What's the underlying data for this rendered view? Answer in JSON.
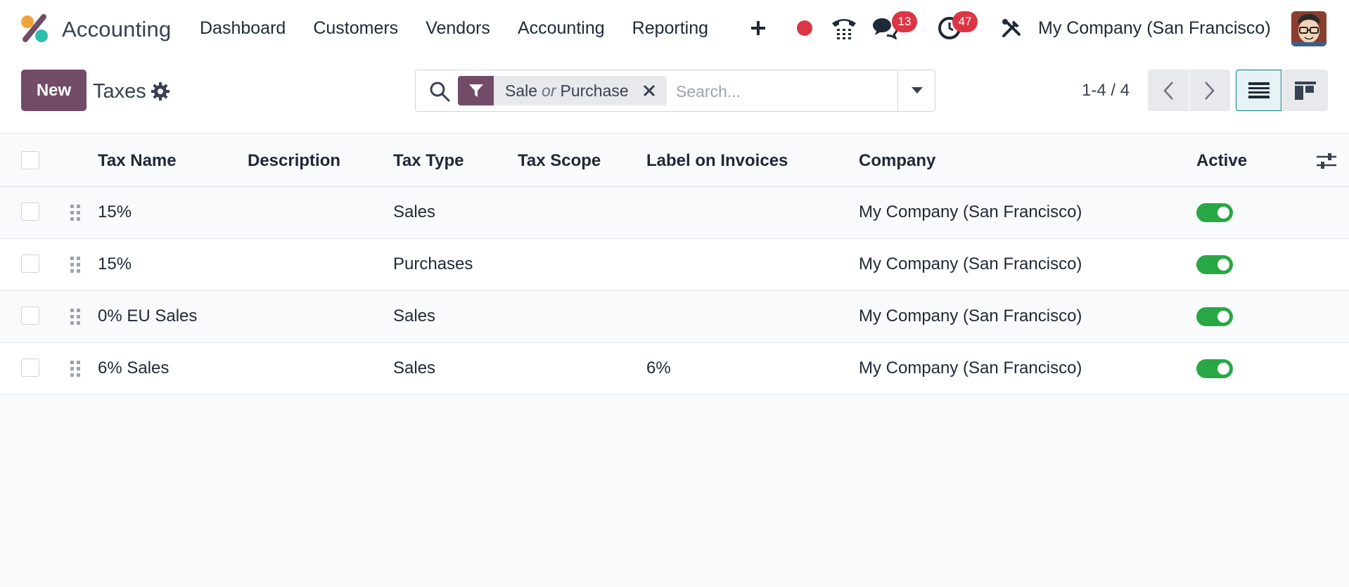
{
  "app": {
    "name": "Accounting",
    "brand_color": "#714b67",
    "accent_teal": "#2ebcae",
    "accent_orange": "#f0a33c"
  },
  "navbar": {
    "menu": [
      "Dashboard",
      "Customers",
      "Vendors",
      "Accounting",
      "Reporting"
    ],
    "messages_badge": "13",
    "activities_badge": "47",
    "company": "My Company (San Francisco)",
    "icons": [
      "plus-icon",
      "recording-dot-icon",
      "phone-icon",
      "chat-icon",
      "clock-icon",
      "tools-icon"
    ]
  },
  "control_panel": {
    "new_label": "New",
    "breadcrumb": "Taxes",
    "search": {
      "facet_values": [
        "Sale",
        "Purchase"
      ],
      "facet_separator": "or",
      "placeholder": "Search..."
    },
    "pager": "1-4 / 4"
  },
  "table": {
    "columns": [
      "Tax Name",
      "Description",
      "Tax Type",
      "Tax Scope",
      "Label on Invoices",
      "Company",
      "Active"
    ],
    "rows": [
      {
        "tax_name": "15%",
        "description": "",
        "tax_type": "Sales",
        "tax_scope": "",
        "label": "",
        "company": "My Company (San Francisco)",
        "active": true
      },
      {
        "tax_name": "15%",
        "description": "",
        "tax_type": "Purchases",
        "tax_scope": "",
        "label": "",
        "company": "My Company (San Francisco)",
        "active": true
      },
      {
        "tax_name": "0% EU Sales",
        "description": "",
        "tax_type": "Sales",
        "tax_scope": "",
        "label": "",
        "company": "My Company (San Francisco)",
        "active": true
      },
      {
        "tax_name": "6% Sales",
        "description": "",
        "tax_type": "Sales",
        "tax_scope": "",
        "label": "6%",
        "company": "My Company (San Francisco)",
        "active": true
      }
    ],
    "active_color": "#28a745"
  }
}
